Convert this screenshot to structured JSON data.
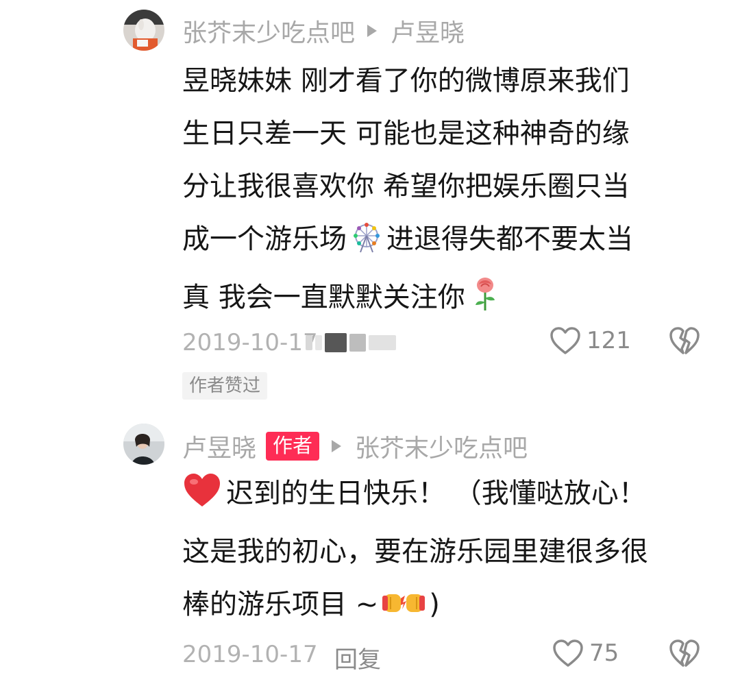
{
  "comments": [
    {
      "username": "张芥末少吃点吧",
      "reply_to": "卢昱晓",
      "text_lines": [
        "昱晓妹妹 刚才看了你的微博原来我们",
        "生日只差一天 可能也是这种神奇的缘",
        "分让我很喜欢你 希望你把娱乐圈只当",
        "成一个游乐场",
        "进退得失都不要太当",
        "真 我会一直默默关注你"
      ],
      "date": "2019-10-17",
      "likes": "121",
      "badge": "作者赞过",
      "emojis": [
        "ferris-wheel-icon",
        "rose-icon"
      ]
    },
    {
      "username": "卢昱晓",
      "author_tag": "作者",
      "reply_to": "张芥末少吃点吧",
      "text_lines": [
        "迟到的生日快乐！ （我懂哒放心！",
        "这是我的初心，要在游乐园里建很多很",
        "棒的游乐项目 ~",
        ")"
      ],
      "date": "2019-10-17",
      "reply_label": "回复",
      "likes": "75",
      "emojis": [
        "red-heart-icon",
        "fist-bump-icon"
      ]
    }
  ],
  "colors": {
    "author_tag": "#fe2c55",
    "meta_text": "#b2b2b2",
    "body_text": "#161616"
  }
}
